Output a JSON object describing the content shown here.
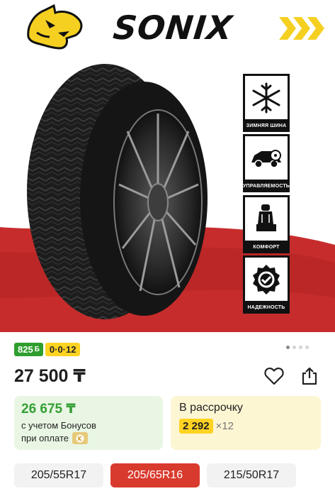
{
  "brand": {
    "name": "SONIX"
  },
  "features": [
    {
      "label": "ЗИМНЯЯ ШИНА",
      "icon": "snowflake-icon"
    },
    {
      "label": "УПРАВЛЯЕМОСТЬ",
      "icon": "car-steering-icon"
    },
    {
      "label": "КОМФОРТ",
      "icon": "car-seat-icon"
    },
    {
      "label": "НАДЕЖНОСТЬ",
      "icon": "reliability-badge-icon"
    }
  ],
  "badges": {
    "bonus": "825",
    "bonus_symbol": "Б",
    "installment": "0·0·12"
  },
  "carousel": {
    "count": 4,
    "active_index": 0
  },
  "price": {
    "value": "27 500 ₸"
  },
  "bonus_card": {
    "amount": "26 675 ₸",
    "line1": "с учетом Бонусов",
    "line2": "при оплате"
  },
  "installment_card": {
    "title": "В рассрочку",
    "payment": "2 292",
    "multiplier": "×12"
  },
  "sizes": [
    {
      "label": "205/55R17",
      "selected": false
    },
    {
      "label": "205/65R16",
      "selected": true
    },
    {
      "label": "215/50R17",
      "selected": false
    }
  ],
  "colors": {
    "accent_red": "#d93a2e",
    "bonus_green": "#2e9e2e",
    "installment_yellow": "#ffd322"
  }
}
